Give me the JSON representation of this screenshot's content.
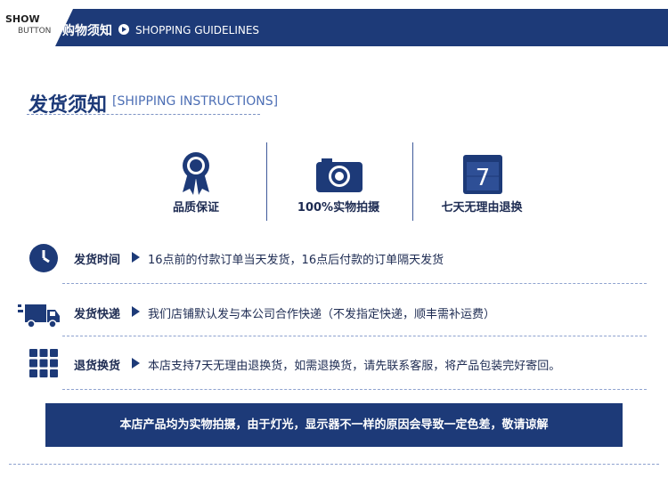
{
  "header": {
    "logo_top": "SHOW",
    "logo_bottom": "BUTTON",
    "title": "购物须知",
    "subtitle": "SHOPPING GUIDELINES"
  },
  "section": {
    "title": "发货须知",
    "subtitle": "[SHIPPING INSTRUCTIONS]"
  },
  "features": [
    {
      "label": "品质保证",
      "icon": "medal-icon"
    },
    {
      "label": "100%实物拍摄",
      "icon": "camera-icon"
    },
    {
      "label": "七天无理由退换",
      "icon": "calendar-7-icon",
      "number": "7"
    }
  ],
  "rows": [
    {
      "label": "发货时间",
      "text": "16点前的付款订单当天发货，16点后付款的订单隔天发货",
      "icon": "clock-icon"
    },
    {
      "label": "发货快递",
      "text": "我们店铺默认发与本公司合作快递（不发指定快递，顺丰需补运费）",
      "icon": "truck-icon"
    },
    {
      "label": "退货换货",
      "text": "本店支持7天无理由退换货，如需退换货，请先联系客服，将产品包装完好寄回。",
      "icon": "grid-icon"
    }
  ],
  "notice": "本店产品均为实物拍摄，由于灯光，显示器不一样的原因会导致一定色差，敬请谅解",
  "colors": {
    "primary": "#1d3a78",
    "accent": "#4d6fb5"
  }
}
